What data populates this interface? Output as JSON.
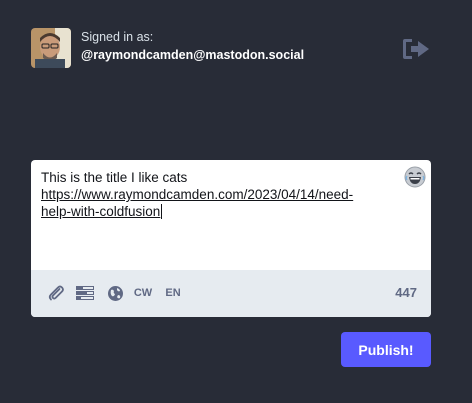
{
  "account": {
    "signed_in_label": "Signed in as:",
    "username": "@raymondcamden@mastodon.social",
    "avatar_icon": "user-avatar",
    "logout_icon": "sign-out-icon"
  },
  "compose": {
    "line1": "This is the title I like cats",
    "link_line1": "https://www.raymondcamden.com/2023/04/14/need-",
    "link_line2": "help-with-coldfusion",
    "emoji_icon": "laughing-emoji-icon"
  },
  "toolbar": {
    "attach_icon": "paperclip-icon",
    "poll_icon": "poll-icon",
    "visibility_icon": "globe-icon",
    "cw_label": "CW",
    "language_label": "EN",
    "char_count": "447"
  },
  "actions": {
    "publish_label": "Publish!"
  },
  "colors": {
    "background": "#282c37",
    "accent": "#595aff",
    "toolbar_bg": "#e6ebf0",
    "icon": "#606984"
  }
}
